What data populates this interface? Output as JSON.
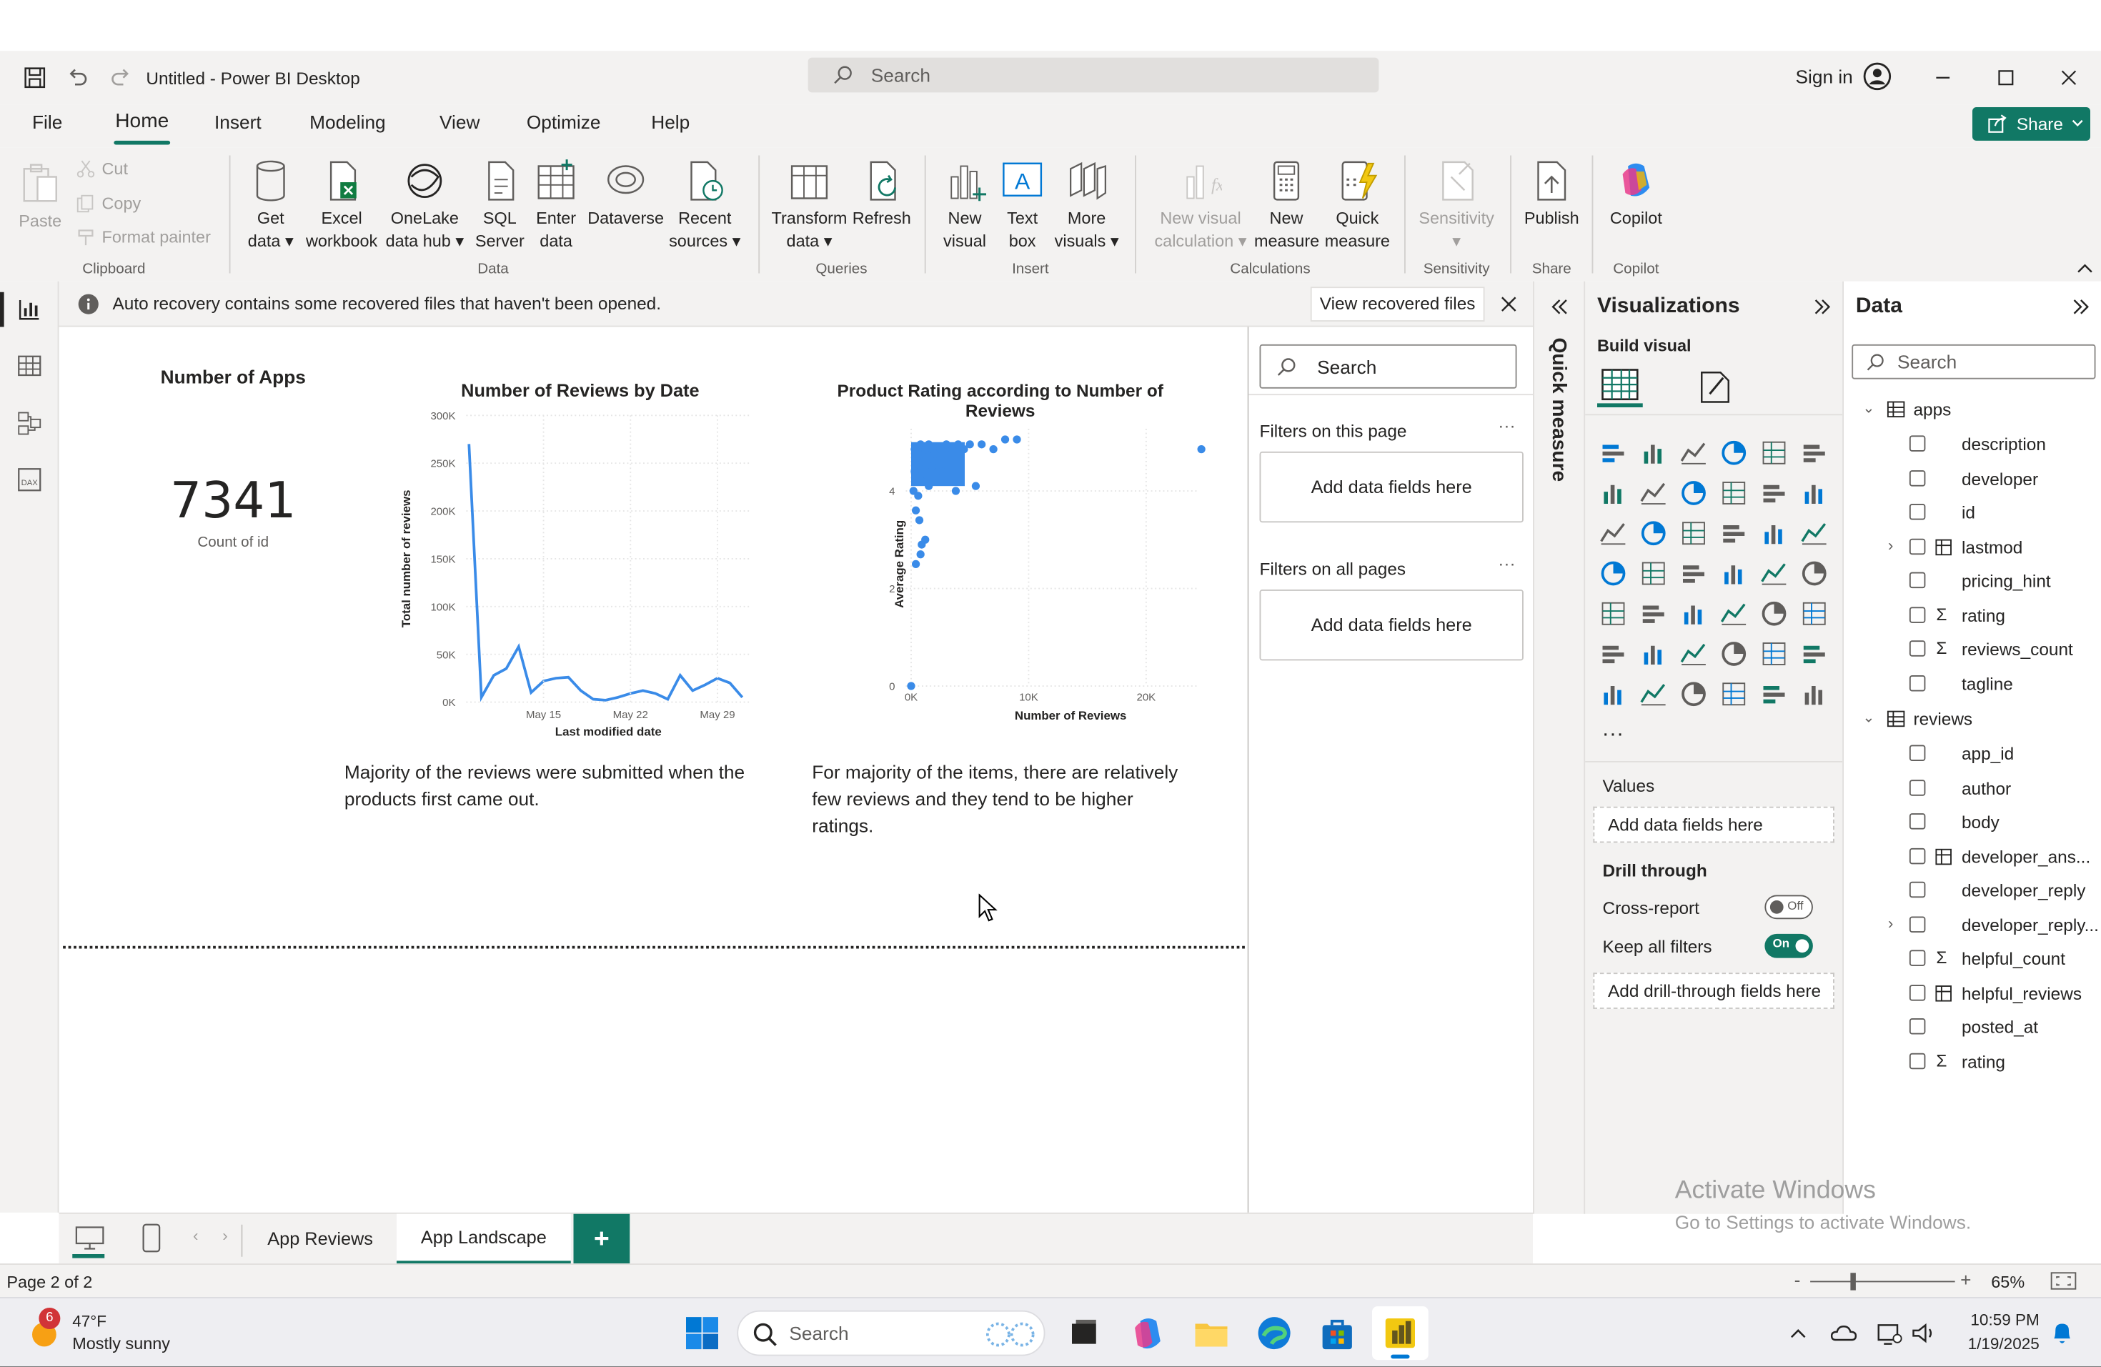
{
  "window": {
    "title": "Untitled - Power BI Desktop",
    "search_placeholder": "Search",
    "sign_in": "Sign in"
  },
  "menu": {
    "tabs": [
      "File",
      "Home",
      "Insert",
      "Modeling",
      "View",
      "Optimize",
      "Help"
    ],
    "share": "Share"
  },
  "ribbon": {
    "clipboard": {
      "paste": "Paste",
      "cut": "Cut",
      "copy": "Copy",
      "format_painter": "Format painter",
      "label": "Clipboard"
    },
    "data": {
      "get_data_1": "Get",
      "get_data_2": "data",
      "excel_1": "Excel",
      "excel_2": "workbook",
      "onelake_1": "OneLake",
      "onelake_2": "data hub",
      "sql_1": "SQL",
      "sql_2": "Server",
      "enter_1": "Enter",
      "enter_2": "data",
      "dataverse": "Dataverse",
      "recent_1": "Recent",
      "recent_2": "sources",
      "label": "Data"
    },
    "queries": {
      "transform_1": "Transform",
      "transform_2": "data",
      "refresh": "Refresh",
      "label": "Queries"
    },
    "insert": {
      "new_visual_1": "New",
      "new_visual_2": "visual",
      "text_box_1": "Text",
      "text_box_2": "box",
      "more_1": "More",
      "more_2": "visuals",
      "label": "Insert"
    },
    "calculations": {
      "nvc_1": "New visual",
      "nvc_2": "calculation",
      "nm_1": "New",
      "nm_2": "measure",
      "qm_1": "Quick",
      "qm_2": "measure",
      "label": "Calculations"
    },
    "sensitivity": {
      "btn": "Sensitivity",
      "label": "Sensitivity"
    },
    "share": {
      "publish": "Publish",
      "label": "Share"
    },
    "copilot": {
      "btn": "Copilot",
      "label": "Copilot"
    }
  },
  "infobar": {
    "message": "Auto recovery contains some recovered files that haven't been opened.",
    "button": "View recovered files"
  },
  "card": {
    "title": "Number of Apps",
    "value": "7341",
    "caption": "Count of id"
  },
  "line_text": "Majority of the reviews were submitted when the products first came out.",
  "scatter_text": "For majority of the items, there are relatively few reviews and they tend to be higher ratings.",
  "chart_data": [
    {
      "type": "line",
      "title": "Number of Reviews by Date",
      "xlabel": "Last modified date",
      "ylabel": "Total number of reviews",
      "x_ticks": [
        "May 15",
        "May 22",
        "May 29"
      ],
      "y_ticks": [
        "300K",
        "250K",
        "200K",
        "150K",
        "100K",
        "50K",
        "0K"
      ],
      "ylim": [
        0,
        300000
      ],
      "series": [
        {
          "values": [
            270000,
            5000,
            28000,
            35000,
            58000,
            10000,
            22000,
            25000,
            26000,
            12000,
            3000,
            2000,
            5000,
            9000,
            12000,
            9000,
            3000,
            28000,
            12000,
            18000,
            25000,
            20000,
            5000
          ]
        }
      ]
    },
    {
      "type": "scatter",
      "title": "Product Rating according to Number of Reviews",
      "xlabel": "Number of Reviews",
      "ylabel": "Average Rating",
      "x_ticks": [
        "0K",
        "10K",
        "20K"
      ],
      "y_ticks": [
        "4",
        "2",
        "0"
      ],
      "xlim": [
        0,
        26000
      ],
      "ylim": [
        0,
        5
      ],
      "points": [
        [
          0,
          0
        ],
        [
          300,
          4.8
        ],
        [
          500,
          4.7
        ],
        [
          800,
          4.9
        ],
        [
          1000,
          4.6
        ],
        [
          1200,
          4.8
        ],
        [
          1500,
          4.9
        ],
        [
          2000,
          4.7
        ],
        [
          2500,
          4.8
        ],
        [
          3000,
          4.9
        ],
        [
          3500,
          4.8
        ],
        [
          4000,
          4.9
        ],
        [
          4500,
          4.8
        ],
        [
          5000,
          4.9
        ],
        [
          6000,
          4.9
        ],
        [
          7000,
          4.8
        ],
        [
          8000,
          5.0
        ],
        [
          9000,
          5.0
        ],
        [
          24700,
          4.8
        ],
        [
          500,
          4.3
        ],
        [
          900,
          4.2
        ],
        [
          1500,
          4.1
        ],
        [
          600,
          3.9
        ],
        [
          400,
          3.6
        ],
        [
          3800,
          4.0
        ],
        [
          5500,
          4.1
        ],
        [
          700,
          3.4
        ],
        [
          1200,
          3.0
        ],
        [
          800,
          2.7
        ],
        [
          400,
          2.5
        ],
        [
          900,
          2.9
        ],
        [
          300,
          4.4
        ],
        [
          200,
          4.0
        ],
        [
          1800,
          4.5
        ],
        [
          2600,
          4.4
        ]
      ]
    }
  ],
  "filters": {
    "search": "Search",
    "on_page": "Filters on this page",
    "on_all": "Filters on all pages",
    "add_fields": "Add data fields here",
    "quick_measure": "Quick measure"
  },
  "viz": {
    "title": "Visualizations",
    "build_visual": "Build visual",
    "values": "Values",
    "add_fields": "Add data fields here",
    "drill": "Drill through",
    "cross_report": "Cross-report",
    "off": "Off",
    "keep_filters": "Keep all filters",
    "on": "On",
    "add_drill": "Add drill-through fields here",
    "more": "..."
  },
  "data_pane": {
    "title": "Data",
    "search": "Search",
    "apps": {
      "name": "apps",
      "fields": [
        "description",
        "developer",
        "id",
        "lastmod",
        "pricing_hint",
        "rating",
        "reviews_count",
        "tagline"
      ]
    },
    "reviews": {
      "name": "reviews",
      "fields": [
        "app_id",
        "author",
        "body",
        "developer_ans...",
        "developer_reply",
        "developer_reply...",
        "helpful_count",
        "helpful_reviews",
        "posted_at",
        "rating"
      ]
    }
  },
  "tabs": {
    "page1": "App Reviews",
    "page2": "App Landscape",
    "add": "+"
  },
  "status": {
    "page": "Page 2 of 2",
    "zoom": "65%"
  },
  "watermark": {
    "line1": "Activate Windows",
    "line2": "Go to Settings to activate Windows."
  },
  "taskbar": {
    "temp": "47°F",
    "weather": "Mostly sunny",
    "badge": "6",
    "search": "Search",
    "time": "10:59 PM",
    "date": "1/19/2025"
  }
}
